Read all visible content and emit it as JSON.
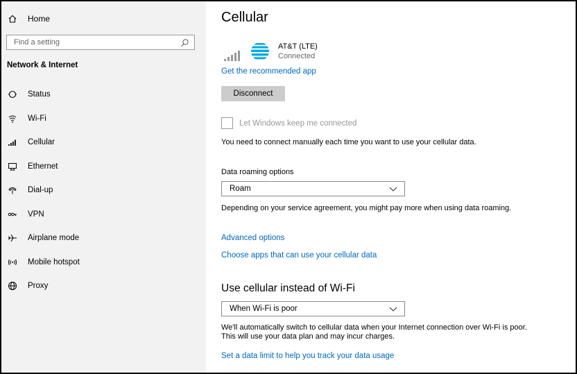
{
  "sidebar": {
    "home_label": "Home",
    "search_placeholder": "Find a setting",
    "section_title": "Network & Internet",
    "items": [
      {
        "label": "Status",
        "icon": "status-icon"
      },
      {
        "label": "Wi-Fi",
        "icon": "wifi-icon"
      },
      {
        "label": "Cellular",
        "icon": "cellular-icon"
      },
      {
        "label": "Ethernet",
        "icon": "ethernet-icon"
      },
      {
        "label": "Dial-up",
        "icon": "dialup-icon"
      },
      {
        "label": "VPN",
        "icon": "vpn-icon"
      },
      {
        "label": "Airplane mode",
        "icon": "airplane-icon"
      },
      {
        "label": "Mobile hotspot",
        "icon": "hotspot-icon"
      },
      {
        "label": "Proxy",
        "icon": "globe-icon"
      }
    ]
  },
  "main": {
    "title": "Cellular",
    "connection": {
      "name": "AT&T (LTE)",
      "status": "Connected"
    },
    "recommended_app_link": "Get the recommended app",
    "disconnect_label": "Disconnect",
    "keep_connected_label": "Let Windows keep me connected",
    "keep_connected_checked": false,
    "manual_connect_text": "You need to connect manually each time you want to use your cellular data.",
    "roaming_label": "Data roaming options",
    "roaming_value": "Roam",
    "roaming_text": "Depending on your service agreement, you might pay more when using data roaming.",
    "advanced_options_link": "Advanced options",
    "choose_apps_link": "Choose apps that can use your cellular data",
    "wifi_section_title": "Use cellular instead of Wi-Fi",
    "wifi_select_value": "When Wi-Fi is poor",
    "wifi_text": "We'll automatically switch to cellular data when your Internet connection over Wi-Fi is poor. This will use your data plan and may incur charges.",
    "data_limit_link": "Set a data limit to help you track your data usage"
  },
  "colors": {
    "link": "#0067c0",
    "sidebar_bg": "#f2f2f2",
    "button_bg": "#cccccc",
    "att_blue": "#00a8e0"
  }
}
